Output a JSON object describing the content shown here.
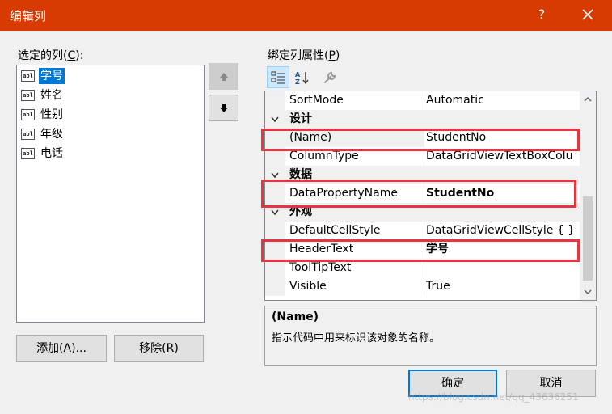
{
  "window": {
    "title": "编辑列",
    "help_label": "?"
  },
  "left": {
    "label_prefix": "选定的列(",
    "label_key": "C",
    "label_suffix": "):",
    "columns": [
      {
        "icon": "abl",
        "name": "学号"
      },
      {
        "icon": "abl",
        "name": "姓名"
      },
      {
        "icon": "abl",
        "name": "性别"
      },
      {
        "icon": "abl",
        "name": "年级"
      },
      {
        "icon": "abl",
        "name": "电话"
      }
    ],
    "add_prefix": "添加(",
    "add_key": "A",
    "add_suffix": ")...",
    "remove_prefix": "移除(",
    "remove_key": "R",
    "remove_suffix": ")"
  },
  "right": {
    "label_prefix": "绑定列属性(",
    "label_key": "P",
    "label_suffix": ")",
    "rows": [
      {
        "name": "SortMode",
        "value": "Automatic"
      },
      {
        "category": "设计"
      },
      {
        "name": "(Name)",
        "value": "StudentNo"
      },
      {
        "name": "ColumnType",
        "value": "DataGridViewTextBoxColu"
      },
      {
        "category": "数据"
      },
      {
        "name": "DataPropertyName",
        "value": "StudentNo"
      },
      {
        "category": "外观"
      },
      {
        "name": "DefaultCellStyle",
        "value": "DataGridViewCellStyle { }"
      },
      {
        "name": "HeaderText",
        "value": "学号"
      },
      {
        "name": "ToolTipText",
        "value": ""
      },
      {
        "name": "Visible",
        "value": "True"
      }
    ],
    "desc_title": "(Name)",
    "desc_text": "指示代码中用来标识该对象的名称。"
  },
  "footer": {
    "ok": "确定",
    "cancel": "取消"
  },
  "watermark": "https://blog.csdn.net/qq_43636251",
  "colors": {
    "titlebar": "#d83b01",
    "selection": "#0078d7",
    "highlight_box": "#e8343f"
  }
}
